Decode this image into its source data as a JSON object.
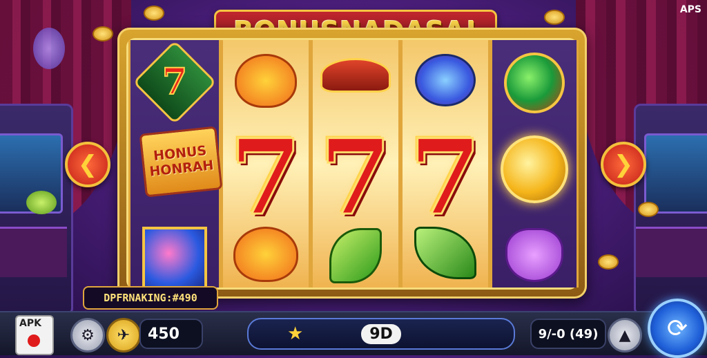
{
  "title": "BONUSNADASA!",
  "corner_badge": "APS",
  "bonus_badge": {
    "line1": "HONUS",
    "line2": "HONRAH"
  },
  "win_display": "DPFRNAKING:#490",
  "bottom": {
    "apk_label": "APK",
    "balance": "450",
    "center_value": "9D",
    "bet_value": "9/-0 (49)"
  },
  "reels": [
    {
      "top": "seven-gem",
      "mid": "bonus-badge",
      "bot": "candy-orb"
    },
    {
      "top": "orange-fruit",
      "mid": "seven",
      "bot": "orange-fruit"
    },
    {
      "top": "hat",
      "mid": "seven",
      "bot": "lime"
    },
    {
      "top": "blue-gem",
      "mid": "seven",
      "bot": "green-leaf"
    },
    {
      "top": "green-orb",
      "mid": "gold-bell",
      "bot": "purple-pig"
    }
  ],
  "colors": {
    "accent": "#f5c542",
    "title_bg": "#c0272d",
    "seven": "#e01b1b",
    "spin": "#1f5fd8"
  }
}
